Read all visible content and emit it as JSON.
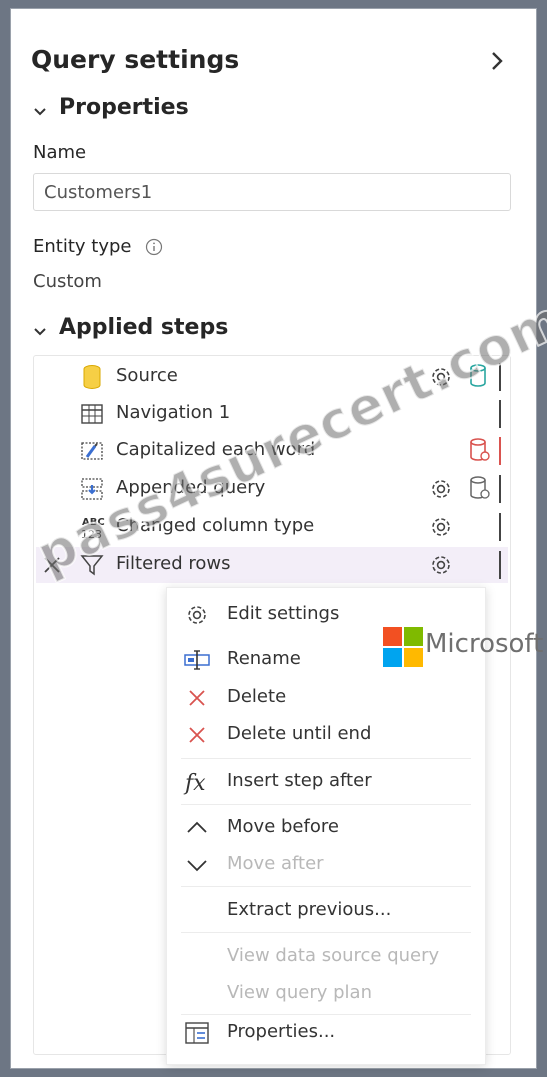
{
  "panel": {
    "title": "Query settings",
    "properties_heading": "Properties",
    "name_label": "Name",
    "name_value": "Customers1",
    "entity_type_label": "Entity type",
    "entity_type_value": "Custom",
    "applied_steps_heading": "Applied steps"
  },
  "steps": [
    {
      "label": "Source",
      "icon": "database-icon"
    },
    {
      "label": "Navigation 1",
      "icon": "table-icon"
    },
    {
      "label": "Capitalized each word",
      "icon": "transform-icon"
    },
    {
      "label": "Appended query",
      "icon": "append-icon"
    },
    {
      "label": "Changed column type",
      "icon": "abc-123-icon"
    },
    {
      "label": "Filtered rows",
      "icon": "filter-icon"
    }
  ],
  "context_menu": {
    "items": [
      {
        "label": "Edit settings",
        "icon": "gear-icon"
      },
      {
        "label": "Rename",
        "icon": "rename-icon"
      },
      {
        "label": "Delete",
        "icon": "close-icon"
      },
      {
        "label": "Delete until end",
        "icon": "close-icon"
      },
      {
        "label": "Insert step after",
        "icon": "fx-icon"
      },
      {
        "label": "Move before",
        "icon": "chevron-up-icon"
      },
      {
        "label": "Move after",
        "icon": "chevron-down-icon"
      },
      {
        "label": "Extract previous...",
        "icon": ""
      },
      {
        "label": "View data source query",
        "icon": ""
      },
      {
        "label": "View query plan",
        "icon": ""
      },
      {
        "label": "Properties...",
        "icon": "properties-icon"
      }
    ]
  },
  "overlay": {
    "brand_text": "Microsoft",
    "watermark": "pass4surecert.com"
  },
  "colors": {
    "accent_yellow": "#f2c230",
    "accent_teal": "#2aa6a0",
    "accent_red": "#d9534f",
    "selected_row": "#f3eef8"
  }
}
